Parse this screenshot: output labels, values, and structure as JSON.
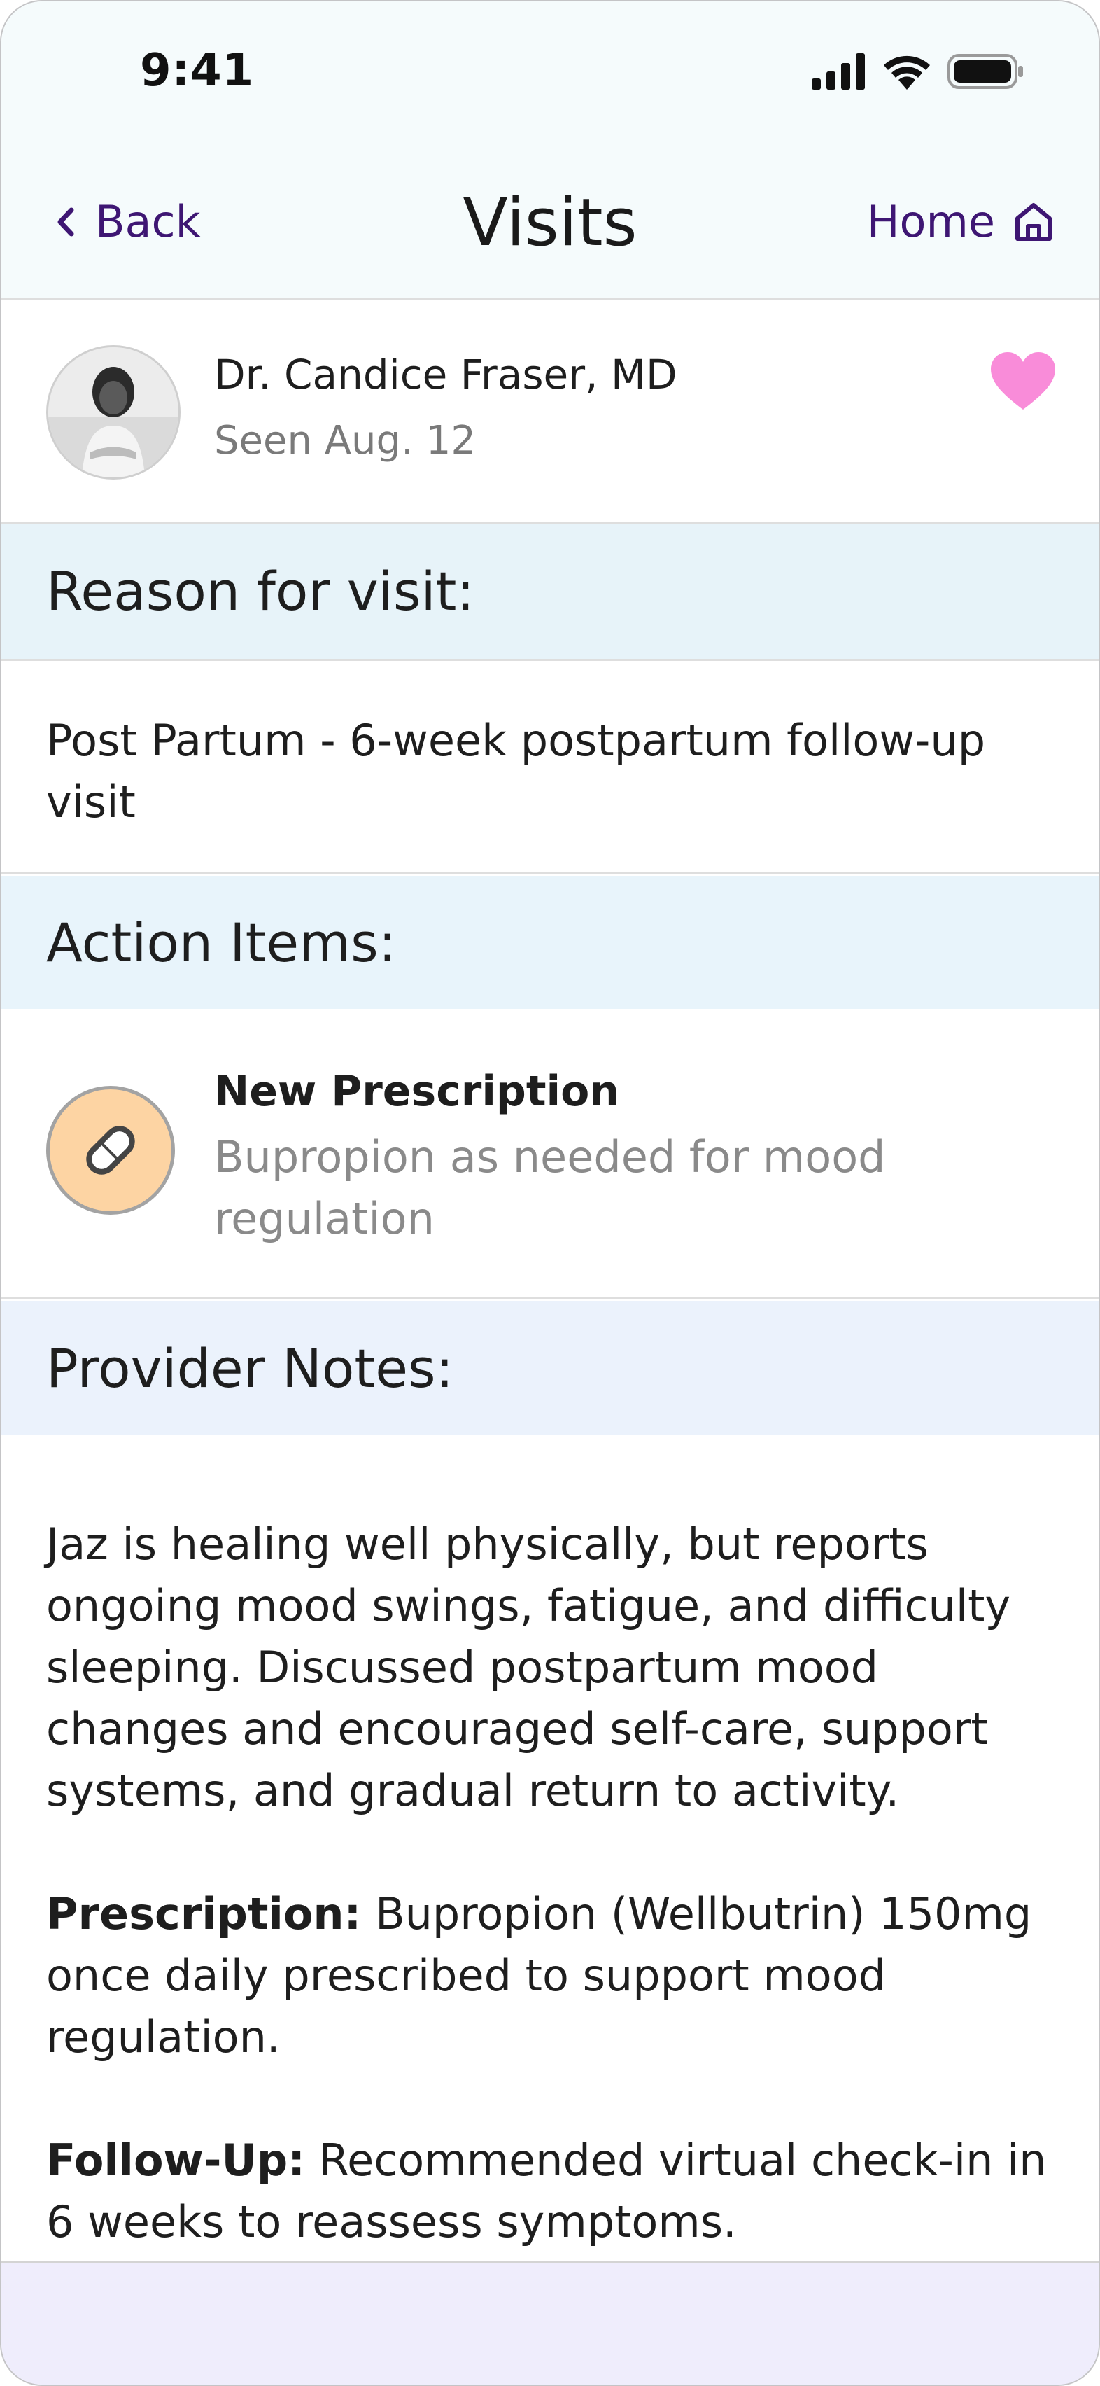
{
  "status_bar": {
    "time": "9:41",
    "icons": [
      "cellular-signal-icon",
      "wifi-icon",
      "battery-icon"
    ]
  },
  "nav": {
    "back_label": "Back",
    "title": "Visits",
    "home_label": "Home"
  },
  "provider": {
    "name": "Dr. Candice Fraser, MD",
    "seen": "Seen Aug. 12",
    "favorite": true
  },
  "reason": {
    "heading": "Reason for visit:",
    "text": "Post Partum - 6-week postpartum follow-up visit"
  },
  "actions": {
    "heading": "Action Items:",
    "items": [
      {
        "title": "New Prescription",
        "description": "Bupropion as needed for mood regulation",
        "icon": "pill-icon"
      }
    ]
  },
  "notes": {
    "heading": "Provider Notes:",
    "summary": "Jaz is healing well physically, but reports ongoing mood swings, fatigue, and difficulty sleeping. Discussed postpartum mood changes and encouraged self-care, support systems, and gradual return to activity.",
    "prescription_label": "Prescription:",
    "prescription_text": " Bupropion (Wellbutrin) 150mg once daily prescribed to support mood regulation.",
    "followup_label": "Follow-Up:",
    "followup_text": " Recommended virtual check-in in 6 weeks to reassess symptoms."
  },
  "colors": {
    "accent": "#3e1673",
    "heart": "#f98cd9",
    "reason_bg": "#e7f3f9",
    "actions_bg": "#e8f4fb",
    "notes_bg": "#ebf2fc",
    "pill_bg": "#fdd4a3",
    "bottom_bar": "#efedfc"
  }
}
